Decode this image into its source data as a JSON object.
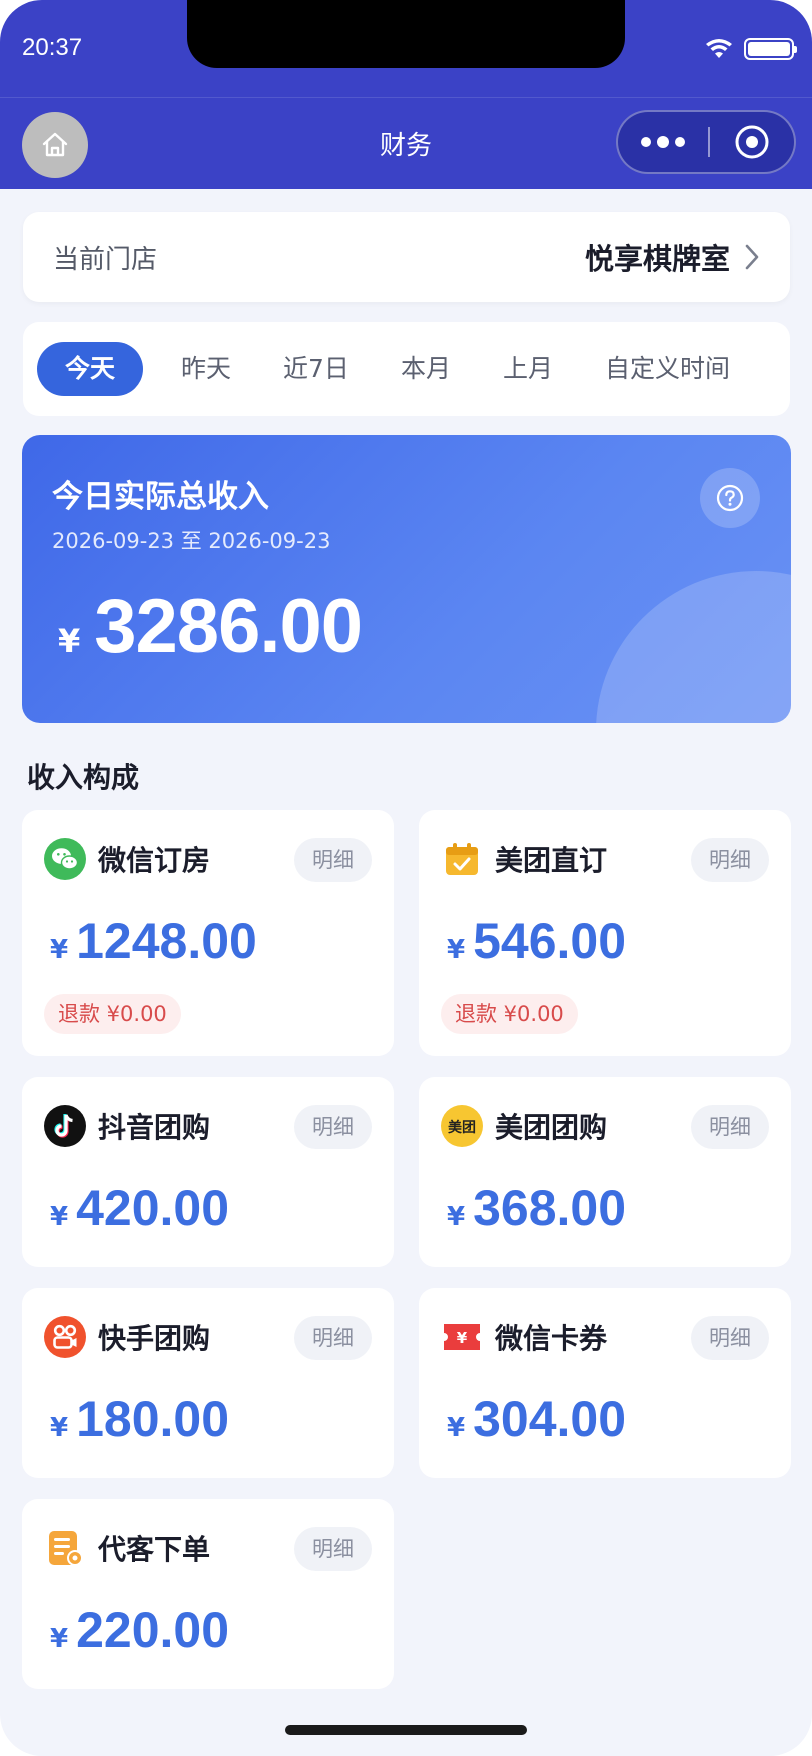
{
  "status_bar": {
    "time": "20:37"
  },
  "nav": {
    "title": "财务"
  },
  "store": {
    "label": "当前门店",
    "name": "悦享棋牌室"
  },
  "tabs": [
    "今天",
    "昨天",
    "近7日",
    "本月",
    "上月",
    "自定义时间"
  ],
  "active_tab": "今天",
  "summary": {
    "title": "今日实际总收入",
    "date_range": "2026-09-23 至 2026-09-23",
    "currency": "¥",
    "amount": "3286.00"
  },
  "section_title": "收入构成",
  "income": [
    {
      "name": "微信订房",
      "detail": "明细",
      "currency": "¥",
      "amount": "1248.00",
      "refund": "退款 ¥0.00",
      "icon": "wechat-icon"
    },
    {
      "name": "美团直订",
      "detail": "明细",
      "currency": "¥",
      "amount": "546.00",
      "refund": "退款 ¥0.00",
      "icon": "calendar-check-icon"
    },
    {
      "name": "抖音团购",
      "detail": "明细",
      "currency": "¥",
      "amount": "420.00",
      "icon": "douyin-icon"
    },
    {
      "name": "美团团购",
      "detail": "明细",
      "currency": "¥",
      "amount": "368.00",
      "icon": "meituan-icon",
      "icon_text": "美团"
    },
    {
      "name": "快手团购",
      "detail": "明细",
      "currency": "¥",
      "amount": "180.00",
      "icon": "kuaishou-icon"
    },
    {
      "name": "微信卡券",
      "detail": "明细",
      "currency": "¥",
      "amount": "304.00",
      "icon": "coupon-icon",
      "icon_text": "¥"
    },
    {
      "name": "代客下单",
      "detail": "明细",
      "currency": "¥",
      "amount": "220.00",
      "icon": "order-list-icon"
    }
  ],
  "colors": {
    "nav_bg": "#3b42c6",
    "accent": "#3565dd",
    "amount": "#3c6ee0",
    "refund": "#d84b4b"
  }
}
